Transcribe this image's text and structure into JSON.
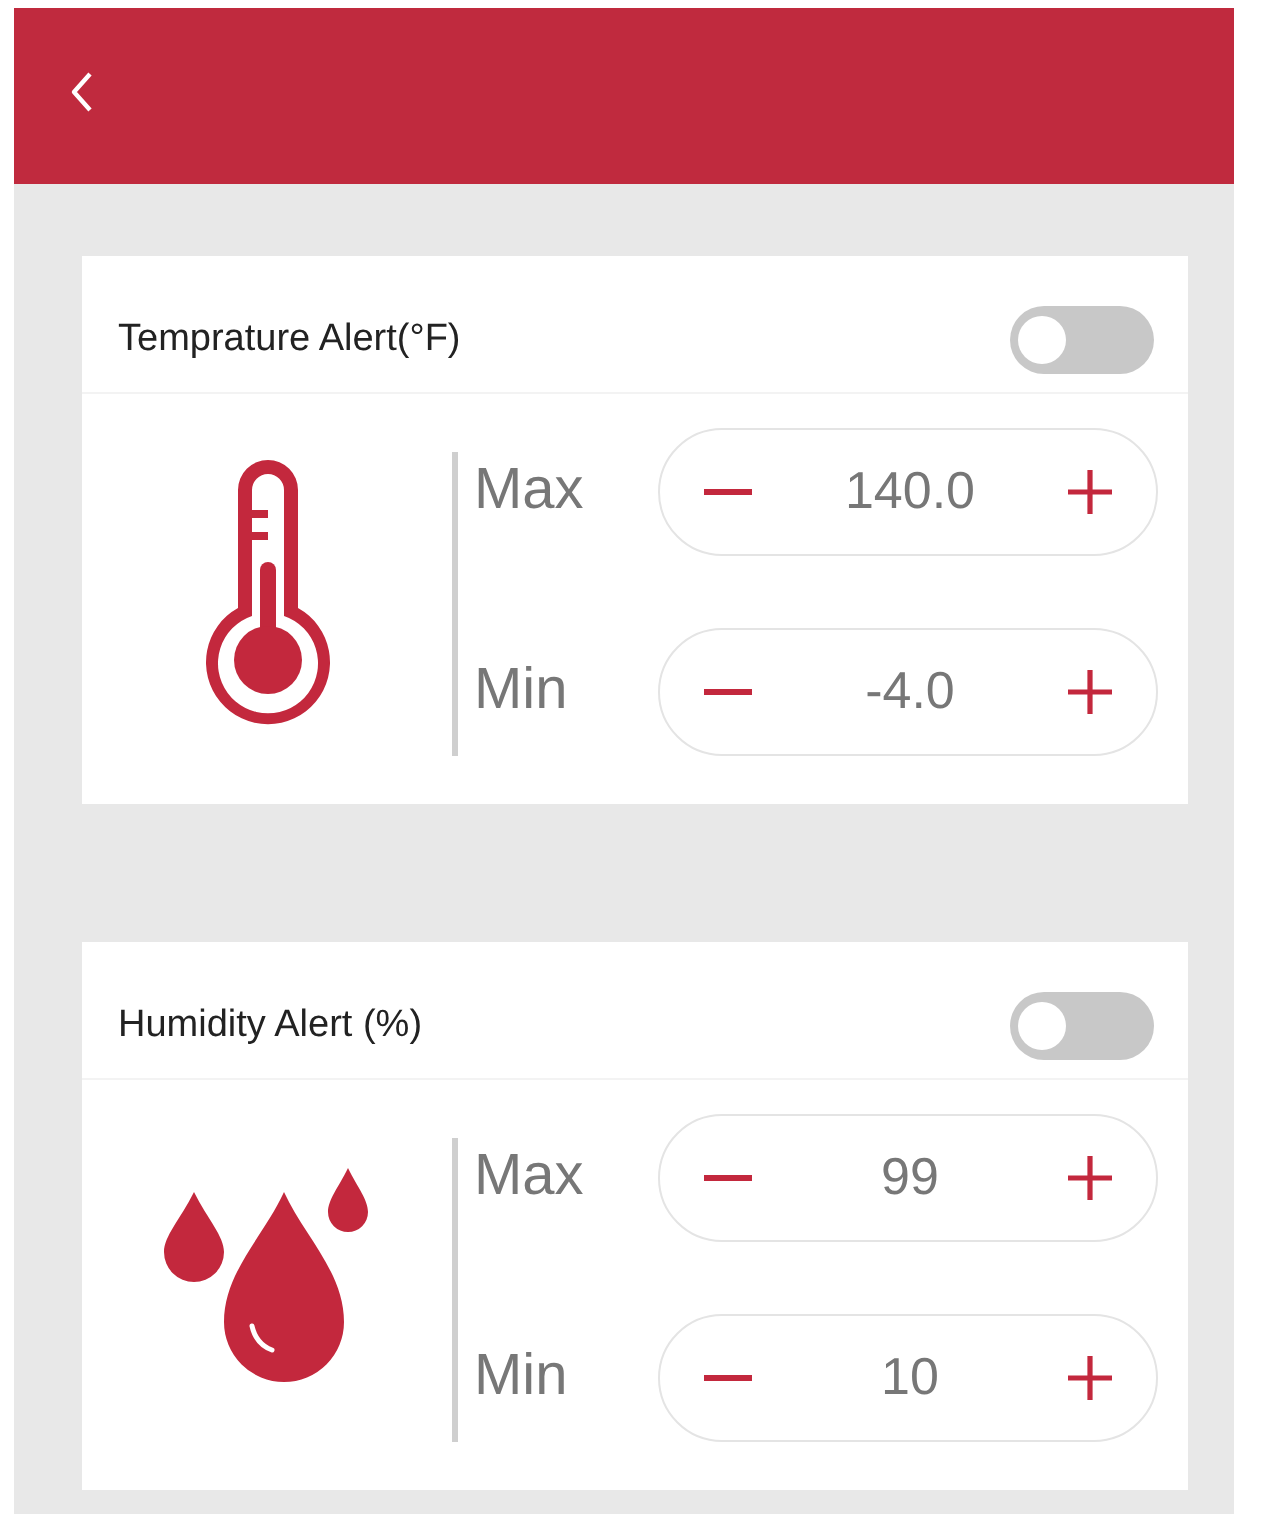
{
  "header": {
    "back": true
  },
  "alerts": [
    {
      "kind": "temperature",
      "title": "Temprature Alert(°F)",
      "on": false,
      "limits": [
        {
          "label": "Max",
          "value": "140.0"
        },
        {
          "label": "Min",
          "value": "-4.0"
        }
      ]
    },
    {
      "kind": "humidity",
      "title": "Humidity Alert (%)",
      "on": false,
      "limits": [
        {
          "label": "Max",
          "value": "99"
        },
        {
          "label": "Min",
          "value": "10"
        }
      ]
    }
  ]
}
